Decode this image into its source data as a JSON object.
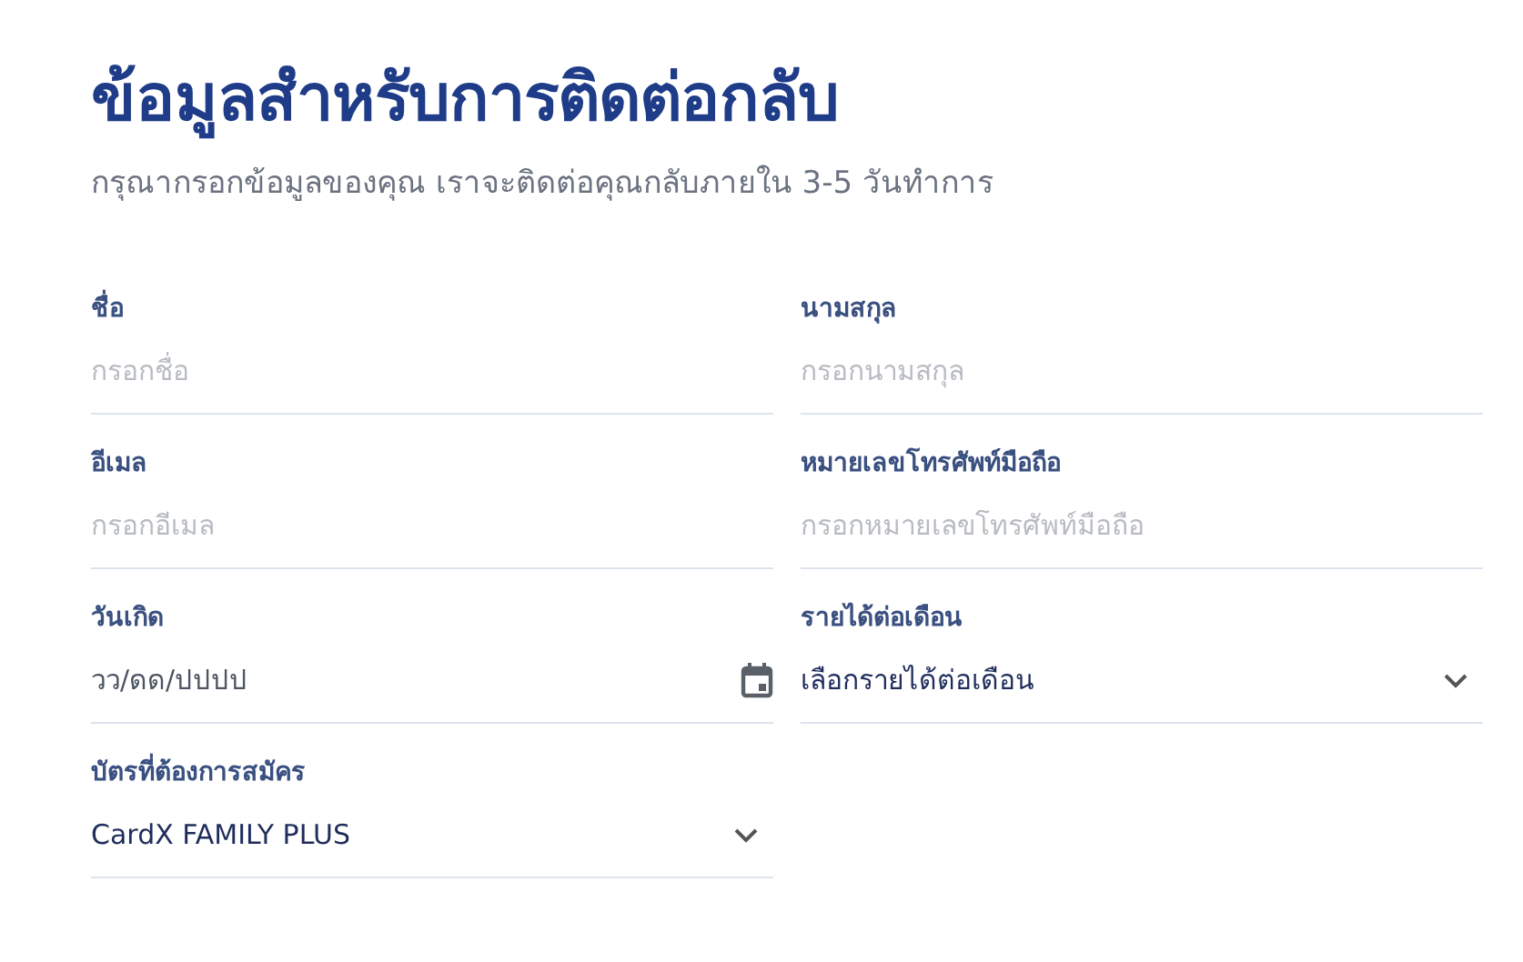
{
  "title": "ข้อมูลสำหรับการติดต่อกลับ",
  "subtitle": "กรุณากรอกข้อมูลของคุณ เราจะติดต่อคุณกลับภายใน 3-5 วันทำการ",
  "fields": [
    {
      "kind": "text",
      "label": "ชื่อ",
      "placeholder": "กรอกชื่อ"
    },
    {
      "kind": "text",
      "label": "นามสกุล",
      "placeholder": "กรอกนามสกุล"
    },
    {
      "kind": "text",
      "label": "อีเมล",
      "placeholder": "กรอกอีเมล"
    },
    {
      "kind": "text",
      "label": "หมายเลขโทรศัพท์มือถือ",
      "placeholder": "กรอกหมายเลขโทรศัพท์มือถือ"
    },
    {
      "kind": "date",
      "label": "วันเกิด",
      "placeholder": "วว/ดด/ปปปป"
    },
    {
      "kind": "select",
      "label": "รายได้ต่อเดือน",
      "value": "เลือกรายได้ต่อเดือน"
    },
    {
      "kind": "select",
      "label": "บัตรที่ต้องการสมัคร",
      "value": "CardX FAMILY PLUS"
    }
  ]
}
